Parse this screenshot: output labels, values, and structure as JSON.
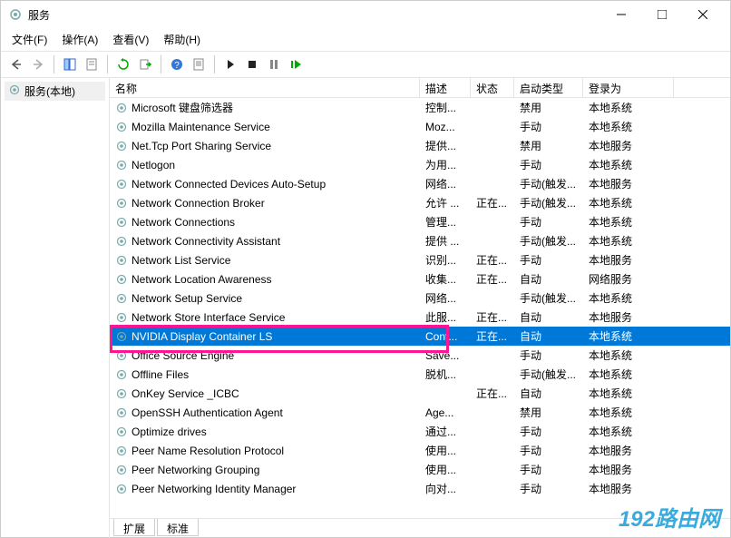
{
  "window": {
    "title": "服务",
    "title_icon": "gear-icon"
  },
  "menu": {
    "file": "文件(F)",
    "action": "操作(A)",
    "view": "查看(V)",
    "help": "帮助(H)"
  },
  "tree": {
    "root_label": "服务(本地)"
  },
  "columns": {
    "name": "名称",
    "description": "描述",
    "status": "状态",
    "startup": "启动类型",
    "logon": "登录为"
  },
  "services": [
    {
      "name": "Microsoft 键盘筛选器",
      "desc": "控制...",
      "status": "",
      "startup": "禁用",
      "logon": "本地系统",
      "selected": false
    },
    {
      "name": "Mozilla Maintenance Service",
      "desc": "Moz...",
      "status": "",
      "startup": "手动",
      "logon": "本地系统",
      "selected": false
    },
    {
      "name": "Net.Tcp Port Sharing Service",
      "desc": "提供...",
      "status": "",
      "startup": "禁用",
      "logon": "本地服务",
      "selected": false
    },
    {
      "name": "Netlogon",
      "desc": "为用...",
      "status": "",
      "startup": "手动",
      "logon": "本地系统",
      "selected": false
    },
    {
      "name": "Network Connected Devices Auto-Setup",
      "desc": "网络...",
      "status": "",
      "startup": "手动(触发...",
      "logon": "本地服务",
      "selected": false
    },
    {
      "name": "Network Connection Broker",
      "desc": "允许 ...",
      "status": "正在...",
      "startup": "手动(触发...",
      "logon": "本地系统",
      "selected": false
    },
    {
      "name": "Network Connections",
      "desc": "管理...",
      "status": "",
      "startup": "手动",
      "logon": "本地系统",
      "selected": false
    },
    {
      "name": "Network Connectivity Assistant",
      "desc": "提供 ...",
      "status": "",
      "startup": "手动(触发...",
      "logon": "本地系统",
      "selected": false
    },
    {
      "name": "Network List Service",
      "desc": "识别...",
      "status": "正在...",
      "startup": "手动",
      "logon": "本地服务",
      "selected": false
    },
    {
      "name": "Network Location Awareness",
      "desc": "收集...",
      "status": "正在...",
      "startup": "自动",
      "logon": "网络服务",
      "selected": false
    },
    {
      "name": "Network Setup Service",
      "desc": "网络...",
      "status": "",
      "startup": "手动(触发...",
      "logon": "本地系统",
      "selected": false
    },
    {
      "name": "Network Store Interface Service",
      "desc": "此服...",
      "status": "正在...",
      "startup": "自动",
      "logon": "本地服务",
      "selected": false
    },
    {
      "name": "NVIDIA Display Container LS",
      "desc": "Cont...",
      "status": "正在...",
      "startup": "自动",
      "logon": "本地系统",
      "selected": true,
      "highlighted": true
    },
    {
      "name": "Office  Source Engine",
      "desc": "Save...",
      "status": "",
      "startup": "手动",
      "logon": "本地系统",
      "selected": false
    },
    {
      "name": "Offline Files",
      "desc": "脱机...",
      "status": "",
      "startup": "手动(触发...",
      "logon": "本地系统",
      "selected": false
    },
    {
      "name": "OnKey Service _ICBC",
      "desc": "",
      "status": "正在...",
      "startup": "自动",
      "logon": "本地系统",
      "selected": false
    },
    {
      "name": "OpenSSH Authentication Agent",
      "desc": "Age...",
      "status": "",
      "startup": "禁用",
      "logon": "本地系统",
      "selected": false
    },
    {
      "name": "Optimize drives",
      "desc": "通过...",
      "status": "",
      "startup": "手动",
      "logon": "本地系统",
      "selected": false
    },
    {
      "name": "Peer Name Resolution Protocol",
      "desc": "使用...",
      "status": "",
      "startup": "手动",
      "logon": "本地服务",
      "selected": false
    },
    {
      "name": "Peer Networking Grouping",
      "desc": "使用...",
      "status": "",
      "startup": "手动",
      "logon": "本地服务",
      "selected": false
    },
    {
      "name": "Peer Networking Identity Manager",
      "desc": "向对...",
      "status": "",
      "startup": "手动",
      "logon": "本地服务",
      "selected": false
    }
  ],
  "tabs": {
    "extended": "扩展",
    "standard": "标准"
  },
  "watermark": "192路由网"
}
